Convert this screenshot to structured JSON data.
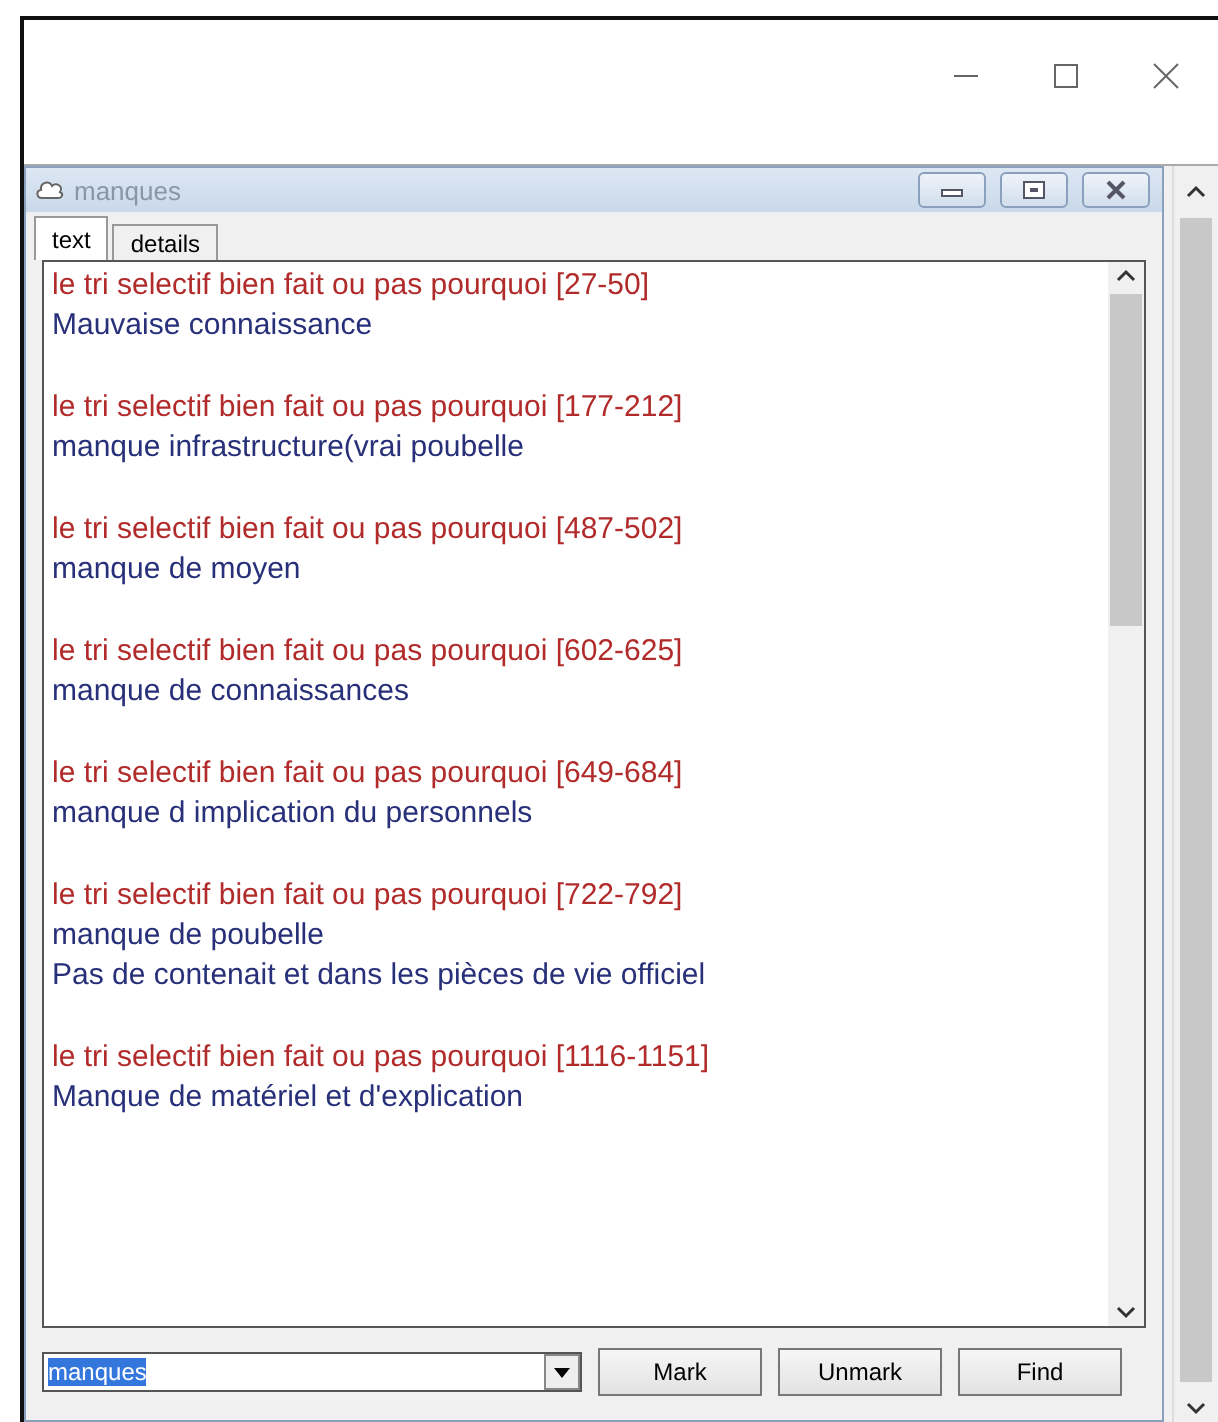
{
  "inner_window": {
    "title": "manques"
  },
  "tabs": [
    {
      "label": "text",
      "selected": true
    },
    {
      "label": "details",
      "selected": false
    }
  ],
  "entries": [
    {
      "source": "le tri selectif bien fait ou pas pourquoi [27-50]",
      "lines": [
        "Mauvaise connaissance"
      ]
    },
    {
      "source": "le tri selectif bien fait ou pas pourquoi [177-212]",
      "lines": [
        "manque infrastructure(vrai poubelle"
      ]
    },
    {
      "source": "le tri selectif bien fait ou pas pourquoi [487-502]",
      "lines": [
        "manque de moyen"
      ]
    },
    {
      "source": "le tri selectif bien fait ou pas pourquoi [602-625]",
      "lines": [
        "manque de connaissances"
      ]
    },
    {
      "source": "le tri selectif bien fait ou pas pourquoi [649-684]",
      "lines": [
        "manque d implication du personnels"
      ]
    },
    {
      "source": "le tri selectif bien fait ou pas pourquoi [722-792]",
      "lines": [
        "manque de poubelle",
        "Pas de contenait et dans les pièces de vie officiel"
      ]
    },
    {
      "source": "le tri selectif bien fait ou pas pourquoi [1116-1151]",
      "lines": [
        "Manque de matériel et d'explication"
      ]
    }
  ],
  "search": {
    "value": "manques"
  },
  "buttons": [
    "Mark",
    "Unmark",
    "Find"
  ]
}
